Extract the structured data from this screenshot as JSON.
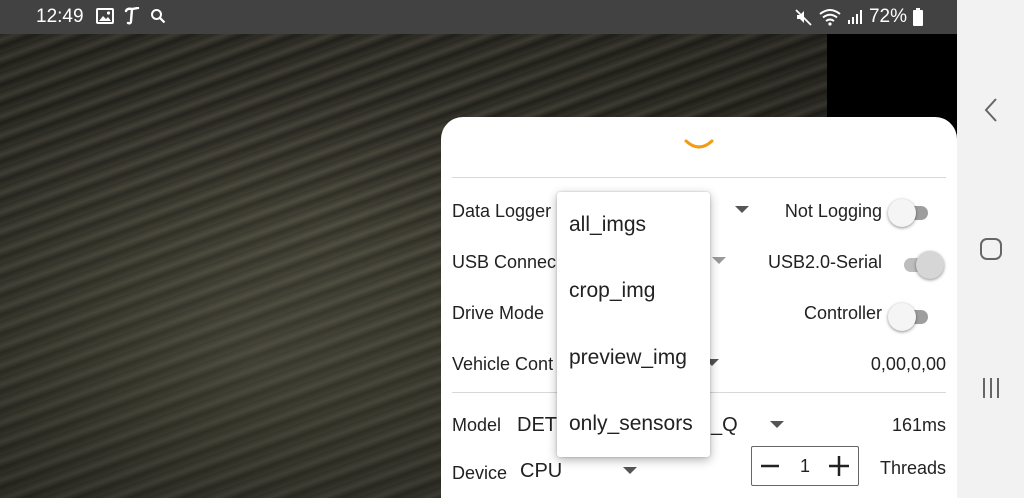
{
  "status_bar": {
    "time": "12:49",
    "left_icons": [
      "image-icon",
      "text-icon",
      "search-icon"
    ],
    "right_icons": [
      "mute-icon",
      "wifi-icon",
      "signal-icon",
      "battery-icon"
    ],
    "battery": "72%"
  },
  "sheet": {
    "rows": {
      "data_logger": {
        "label": "Data Logger",
        "status": "Not Logging"
      },
      "usb": {
        "label": "USB Connec",
        "status": "USB2.0-Serial"
      },
      "drive_mode": {
        "label": "Drive Mode",
        "status": "Controller"
      },
      "vehicle_control": {
        "label": "Vehicle Cont",
        "value": "0,00,0,00"
      },
      "model": {
        "label": "Model",
        "value_left": "DET",
        "value_right": "_Q",
        "latency": "161ms"
      },
      "device": {
        "label": "Device",
        "value": "CPU",
        "threads_label": "Threads",
        "threads_value": "1"
      }
    }
  },
  "dropdown": {
    "options": [
      "all_imgs",
      "crop_img",
      "preview_img",
      "only_sensors"
    ]
  },
  "colors": {
    "accent": "#f39c12",
    "status_bar": "#424242",
    "nav_bar": "#f2f2f2"
  }
}
